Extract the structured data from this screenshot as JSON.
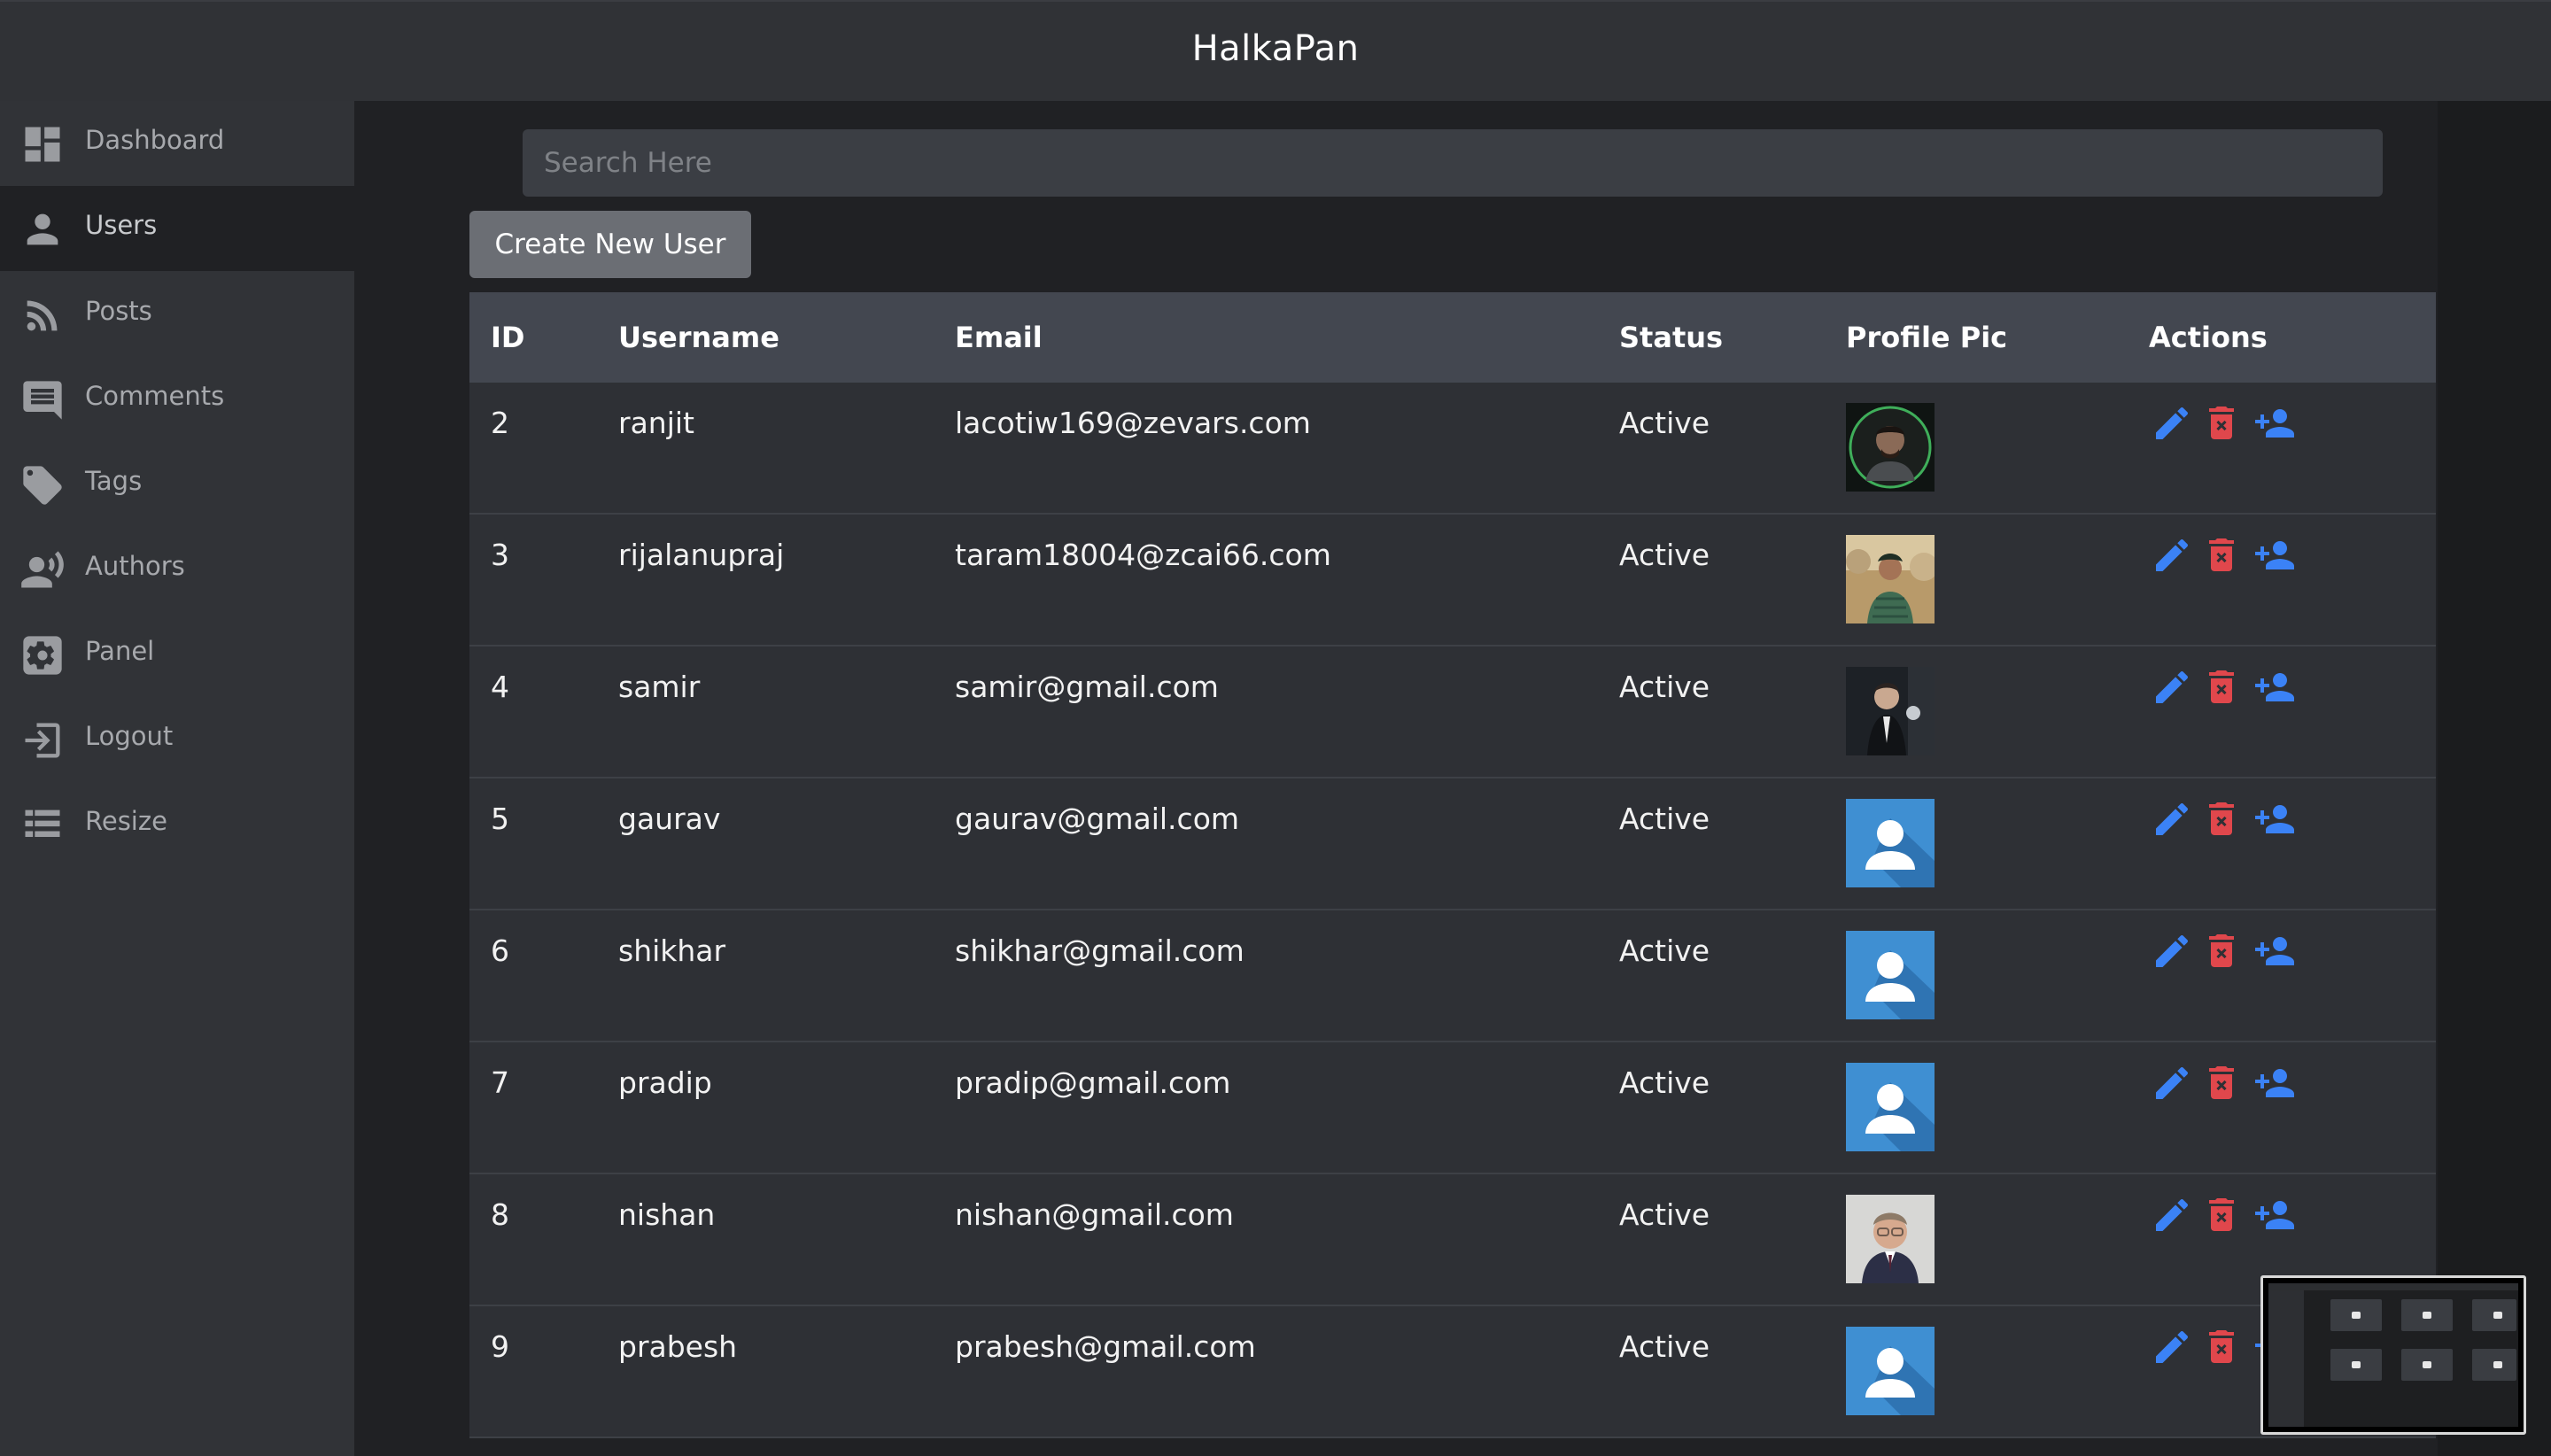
{
  "app": {
    "title": "HalkaPan"
  },
  "sidebar": {
    "items": [
      {
        "label": "Dashboard",
        "icon": "dashboard-icon",
        "active": false
      },
      {
        "label": "Users",
        "icon": "user-icon",
        "active": true
      },
      {
        "label": "Posts",
        "icon": "rss-icon",
        "active": false
      },
      {
        "label": "Comments",
        "icon": "comment-icon",
        "active": false
      },
      {
        "label": "Tags",
        "icon": "tag-icon",
        "active": false
      },
      {
        "label": "Authors",
        "icon": "authors-icon",
        "active": false
      },
      {
        "label": "Panel",
        "icon": "gear-icon",
        "active": false
      },
      {
        "label": "Logout",
        "icon": "logout-icon",
        "active": false
      },
      {
        "label": "Resize",
        "icon": "list-icon",
        "active": false
      }
    ]
  },
  "search": {
    "placeholder": "Search Here",
    "value": ""
  },
  "toolbar": {
    "create_label": "Create New User"
  },
  "table": {
    "columns": [
      "ID",
      "Username",
      "Email",
      "Status",
      "Profile Pic",
      "Actions"
    ],
    "rows": [
      {
        "id": "2",
        "username": "ranjit",
        "email": "lacotiw169@zevars.com",
        "status": "Active",
        "pic": "photo-green-ring"
      },
      {
        "id": "3",
        "username": "rijalanupraj",
        "email": "taram18004@zcai66.com",
        "status": "Active",
        "pic": "photo-outdoor"
      },
      {
        "id": "4",
        "username": "samir",
        "email": "samir@gmail.com",
        "status": "Active",
        "pic": "photo-dark-suit"
      },
      {
        "id": "5",
        "username": "gaurav",
        "email": "gaurav@gmail.com",
        "status": "Active",
        "pic": "default-avatar"
      },
      {
        "id": "6",
        "username": "shikhar",
        "email": "shikhar@gmail.com",
        "status": "Active",
        "pic": "default-avatar"
      },
      {
        "id": "7",
        "username": "pradip",
        "email": "pradip@gmail.com",
        "status": "Active",
        "pic": "default-avatar"
      },
      {
        "id": "8",
        "username": "nishan",
        "email": "nishan@gmail.com",
        "status": "Active",
        "pic": "photo-glasses"
      },
      {
        "id": "9",
        "username": "prabesh",
        "email": "prabesh@gmail.com",
        "status": "Active",
        "pic": "default-avatar"
      }
    ]
  },
  "colors": {
    "edit": "#3b82f6",
    "delete": "#e0474c",
    "add_user": "#3b82f6",
    "default_avatar_bg": "#3f8fd2"
  },
  "actions": {
    "icons": [
      "edit-icon",
      "delete-icon",
      "add-user-icon"
    ]
  }
}
